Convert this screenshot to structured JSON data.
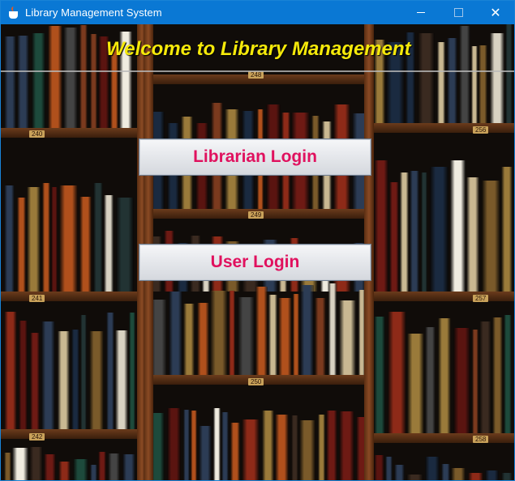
{
  "window": {
    "title": "Library Management System"
  },
  "controls": {
    "minimize": "—",
    "maximize": "☐",
    "close": "✕"
  },
  "main": {
    "heading": "Welcome to Library Management",
    "buttons": {
      "librarian": "Librarian Login",
      "user": "User Login"
    }
  },
  "shelf_labels": [
    "240",
    "248",
    "256",
    "249",
    "241",
    "257",
    "250",
    "242",
    "258"
  ],
  "colors": {
    "heading": "#f5e90a",
    "button_text": "#e0115e",
    "titlebar": "#0a78d4"
  }
}
